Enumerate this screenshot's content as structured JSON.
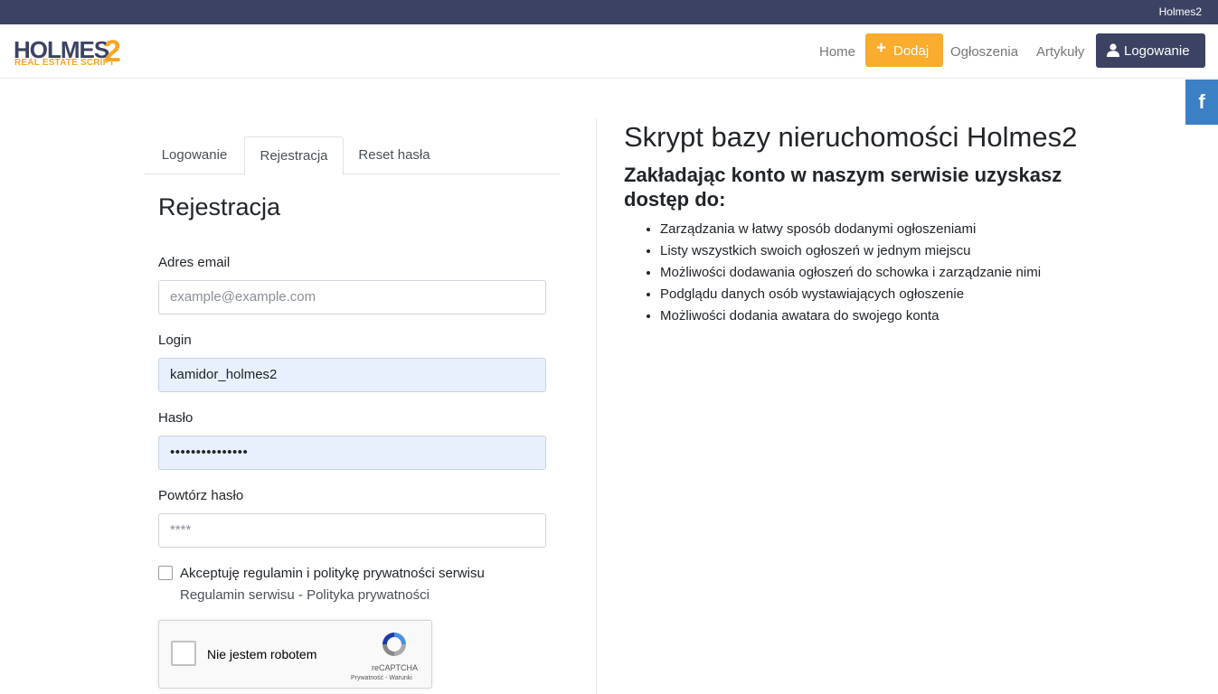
{
  "topbar": {
    "site_name": "Holmes2"
  },
  "logo": {
    "word": "HOLMES",
    "number": "2",
    "tagline": "REAL ESTATE SCRIPT"
  },
  "nav": {
    "home": "Home",
    "add": "Dodaj",
    "listings": "Ogłoszenia",
    "articles": "Artykuły",
    "login": "Logowanie"
  },
  "social": {
    "facebook": "f"
  },
  "tabs": [
    "Logowanie",
    "Rejestracja",
    "Reset hasła"
  ],
  "form": {
    "title": "Rejestracja",
    "email_label": "Adres email",
    "email_placeholder": "example@example.com",
    "login_label": "Login",
    "login_value": "kamidor_holmes2",
    "password_label": "Hasło",
    "password_value": "•••••••••••••••",
    "repeat_label": "Powtórz hasło",
    "repeat_placeholder": "****",
    "accept_label": "Akceptuję regulamin i politykę prywatności serwisu",
    "terms_link": "Regulamin serwisu",
    "terms_sep": " - ",
    "privacy_link": "Polityka prywatności"
  },
  "recaptcha": {
    "label": "Nie jestem robotem",
    "brand": "reCAPTCHA",
    "links": "Prywatność - Warunki"
  },
  "info": {
    "title": "Skrypt bazy nieruchomości Holmes2",
    "subtitle": "Zakładając konto w naszym serwisie uzyskasz dostęp do:",
    "features": [
      "Zarządzania w łatwy sposób dodanymi ogłoszeniami",
      "Listy wszystkich swoich ogłoszeń w jednym miejscu",
      "Możliwości dodawania ogłoszeń do schowka i zarządzanie nimi",
      "Podglądu danych osób wystawiających ogłoszenie",
      "Możliwości dodania awatara do swojego konta"
    ]
  },
  "colors": {
    "navy": "#3c4261",
    "orange": "#f9ac2d",
    "facebook": "#3b7fc4",
    "autofill": "#e8f0fe"
  }
}
